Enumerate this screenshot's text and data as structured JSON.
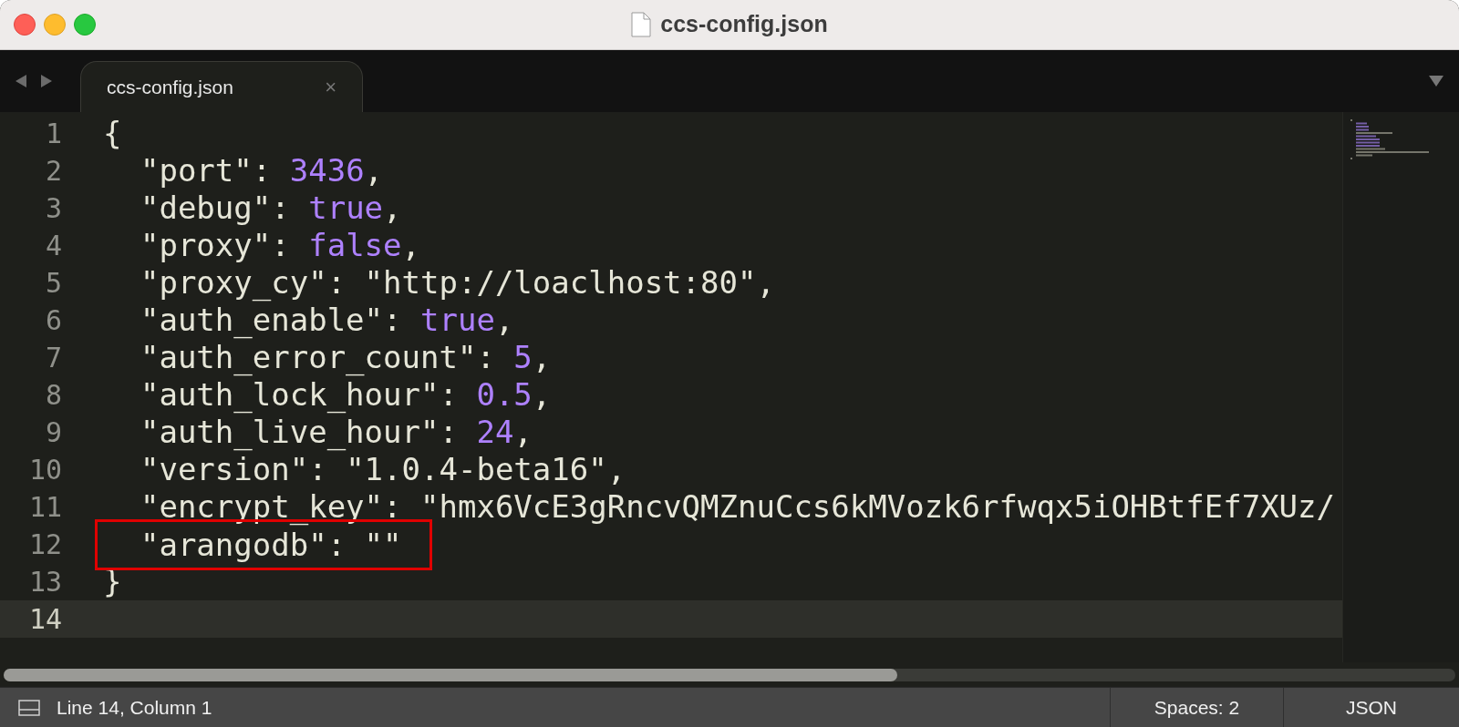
{
  "window": {
    "title": "ccs-config.json"
  },
  "tabs": [
    {
      "label": "ccs-config.json",
      "selected": true,
      "close": "×"
    }
  ],
  "editor": {
    "lines": [
      {
        "number": "1",
        "current": false,
        "boxed": false,
        "tokens": [
          {
            "kind": "punct",
            "text": "{"
          }
        ]
      },
      {
        "number": "2",
        "current": false,
        "boxed": false,
        "tokens": [
          {
            "kind": "key",
            "text": "  \"port\""
          },
          {
            "kind": "punct",
            "text": ": "
          },
          {
            "kind": "number",
            "text": "3436"
          },
          {
            "kind": "punct",
            "text": ","
          }
        ]
      },
      {
        "number": "3",
        "current": false,
        "boxed": false,
        "tokens": [
          {
            "kind": "key",
            "text": "  \"debug\""
          },
          {
            "kind": "punct",
            "text": ": "
          },
          {
            "kind": "constant",
            "text": "true"
          },
          {
            "kind": "punct",
            "text": ","
          }
        ]
      },
      {
        "number": "4",
        "current": false,
        "boxed": false,
        "tokens": [
          {
            "kind": "key",
            "text": "  \"proxy\""
          },
          {
            "kind": "punct",
            "text": ": "
          },
          {
            "kind": "constant",
            "text": "false"
          },
          {
            "kind": "punct",
            "text": ","
          }
        ]
      },
      {
        "number": "5",
        "current": false,
        "boxed": false,
        "tokens": [
          {
            "kind": "key",
            "text": "  \"proxy_cy\""
          },
          {
            "kind": "punct",
            "text": ": "
          },
          {
            "kind": "string",
            "text": "\"http://loaclhost:80\""
          },
          {
            "kind": "punct",
            "text": ","
          }
        ]
      },
      {
        "number": "6",
        "current": false,
        "boxed": false,
        "tokens": [
          {
            "kind": "key",
            "text": "  \"auth_enable\""
          },
          {
            "kind": "punct",
            "text": ": "
          },
          {
            "kind": "constant",
            "text": "true"
          },
          {
            "kind": "punct",
            "text": ","
          }
        ]
      },
      {
        "number": "7",
        "current": false,
        "boxed": false,
        "tokens": [
          {
            "kind": "key",
            "text": "  \"auth_error_count\""
          },
          {
            "kind": "punct",
            "text": ": "
          },
          {
            "kind": "number",
            "text": "5"
          },
          {
            "kind": "punct",
            "text": ","
          }
        ]
      },
      {
        "number": "8",
        "current": false,
        "boxed": false,
        "tokens": [
          {
            "kind": "key",
            "text": "  \"auth_lock_hour\""
          },
          {
            "kind": "punct",
            "text": ": "
          },
          {
            "kind": "number",
            "text": "0.5"
          },
          {
            "kind": "punct",
            "text": ","
          }
        ]
      },
      {
        "number": "9",
        "current": false,
        "boxed": false,
        "tokens": [
          {
            "kind": "key",
            "text": "  \"auth_live_hour\""
          },
          {
            "kind": "punct",
            "text": ": "
          },
          {
            "kind": "number",
            "text": "24"
          },
          {
            "kind": "punct",
            "text": ","
          }
        ]
      },
      {
        "number": "10",
        "current": false,
        "boxed": false,
        "tokens": [
          {
            "kind": "key",
            "text": "  \"version\""
          },
          {
            "kind": "punct",
            "text": ": "
          },
          {
            "kind": "string",
            "text": "\"1.0.4-beta16\""
          },
          {
            "kind": "punct",
            "text": ","
          }
        ]
      },
      {
        "number": "11",
        "current": false,
        "boxed": false,
        "tokens": [
          {
            "kind": "key",
            "text": "  \"encrypt_key\""
          },
          {
            "kind": "punct",
            "text": ": "
          },
          {
            "kind": "string",
            "text": "\"hmx6VcE3gRncvQMZnuCcs6kMVozk6rfwqx5iOHBtfEf7XUz/"
          }
        ]
      },
      {
        "number": "12",
        "current": false,
        "boxed": true,
        "tokens": [
          {
            "kind": "key",
            "text": "  \"arangodb\""
          },
          {
            "kind": "punct",
            "text": ": "
          },
          {
            "kind": "string",
            "text": "\"\""
          }
        ]
      },
      {
        "number": "13",
        "current": false,
        "boxed": false,
        "tokens": [
          {
            "kind": "punct",
            "text": "}"
          }
        ]
      },
      {
        "number": "14",
        "current": true,
        "boxed": false
      }
    ]
  },
  "status_bar": {
    "position": "Line 14, Column 1",
    "indentation": "Spaces: 2",
    "syntax": "JSON"
  }
}
